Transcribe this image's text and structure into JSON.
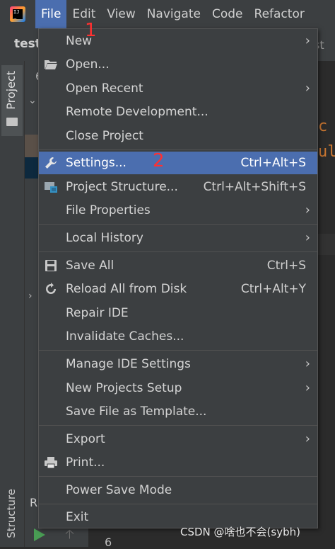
{
  "menubar": {
    "items": [
      {
        "label": "File"
      },
      {
        "label": "Edit"
      },
      {
        "label": "View"
      },
      {
        "label": "Navigate"
      },
      {
        "label": "Code"
      },
      {
        "label": "Refactor"
      }
    ]
  },
  "project_name": "test",
  "breadcrumb_tail": "st",
  "tool_windows": {
    "project": "Project",
    "structure": "Structure"
  },
  "tree": {
    "first_line": "6",
    "bottom_letter": "R"
  },
  "editor": {
    "line_a": "c",
    "line_b": "ul",
    "bottom_line_number": "6"
  },
  "file_menu": {
    "items": [
      {
        "label": "New",
        "submenu": true
      },
      {
        "label": "Open...",
        "icon": "folder-open-icon"
      },
      {
        "label": "Open Recent",
        "submenu": true
      },
      {
        "label": "Remote Development..."
      },
      {
        "label": "Close Project"
      },
      {
        "label": "Settings...",
        "shortcut": "Ctrl+Alt+S",
        "icon": "wrench-icon",
        "highlighted": true
      },
      {
        "label": "Project Structure...",
        "shortcut": "Ctrl+Alt+Shift+S",
        "icon": "project-structure-icon"
      },
      {
        "label": "File Properties",
        "submenu": true
      },
      {
        "label": "Local History",
        "submenu": true
      },
      {
        "label": "Save All",
        "shortcut": "Ctrl+S",
        "icon": "save-icon"
      },
      {
        "label": "Reload All from Disk",
        "shortcut": "Ctrl+Alt+Y",
        "icon": "reload-icon"
      },
      {
        "label": "Repair IDE"
      },
      {
        "label": "Invalidate Caches..."
      },
      {
        "label": "Manage IDE Settings",
        "submenu": true
      },
      {
        "label": "New Projects Setup",
        "submenu": true
      },
      {
        "label": "Save File as Template..."
      },
      {
        "label": "Export",
        "submenu": true
      },
      {
        "label": "Print...",
        "icon": "print-icon"
      },
      {
        "label": "Power Save Mode"
      },
      {
        "label": "Exit"
      }
    ]
  },
  "annotations": {
    "one": "1",
    "two": "2"
  },
  "watermark": "CSDN @啥也不会(sybh)",
  "colors": {
    "highlight": "#4b6eaf",
    "menu_bg": "#3c3f41",
    "annotation": "#ff3030"
  }
}
